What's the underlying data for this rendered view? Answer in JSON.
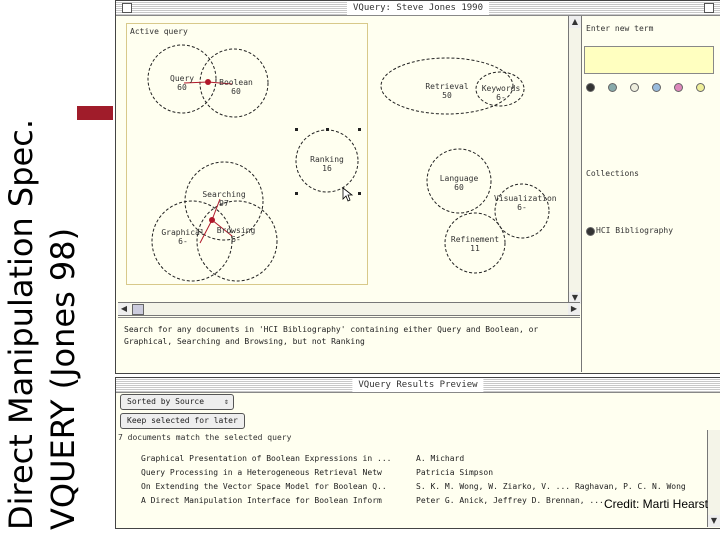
{
  "slide": {
    "title_line1": "Direct Manipulation Spec.",
    "title_line2": "VQUERY (Jones 98)",
    "credit": "Credit: Marti Hearst",
    "accent_color": "#a01c2a"
  },
  "main_window": {
    "title": "VQuery: Steve Jones 1990",
    "active_query_label": "Active query",
    "circles": [
      {
        "label": "Query",
        "count": "60"
      },
      {
        "label": "Boolean",
        "count": "60"
      },
      {
        "label": "Retrieval",
        "count": "50"
      },
      {
        "label": "Keywords",
        "count": "6-"
      },
      {
        "label": "Ranking",
        "count": "16"
      },
      {
        "label": "Searching",
        "count": "97"
      },
      {
        "label": "Graphical",
        "count": "6-"
      },
      {
        "label": "Browsing",
        "count": "6-"
      },
      {
        "label": "Language",
        "count": "60"
      },
      {
        "label": "Visualization",
        "count": "6-"
      },
      {
        "label": "Refinement",
        "count": "11"
      }
    ],
    "description": "Search for any documents in 'HCI Bibliography' containing either Query and Boolean, or Graphical, Searching and Browsing, but not Ranking",
    "side_panel": {
      "enter_term_label": "Enter new term",
      "collections_label": "Collections",
      "collection_item": "HCI Bibliography"
    }
  },
  "results_window": {
    "title": "VQuery Results Preview",
    "sort_label": "Sorted by Source",
    "keep_button": "Keep selected for later",
    "match_text": "7 documents match the selected query",
    "results": [
      {
        "title": "Graphical Presentation of Boolean Expressions in ...",
        "author": "A. Michard"
      },
      {
        "title": "Query Processing in a Heterogeneous Retrieval Netw",
        "author": "Patricia Simpson"
      },
      {
        "title": "On Extending the Vector Space Model for Boolean Q..",
        "author": "S. K. M. Wong, W. Ziarko, V. ... Raghavan, P. C. N. Wong"
      },
      {
        "title": "A Direct Manipulation Interface for Boolean Inform",
        "author": "Peter G. Anick, Jeffrey D. Brennan, ..."
      }
    ]
  }
}
